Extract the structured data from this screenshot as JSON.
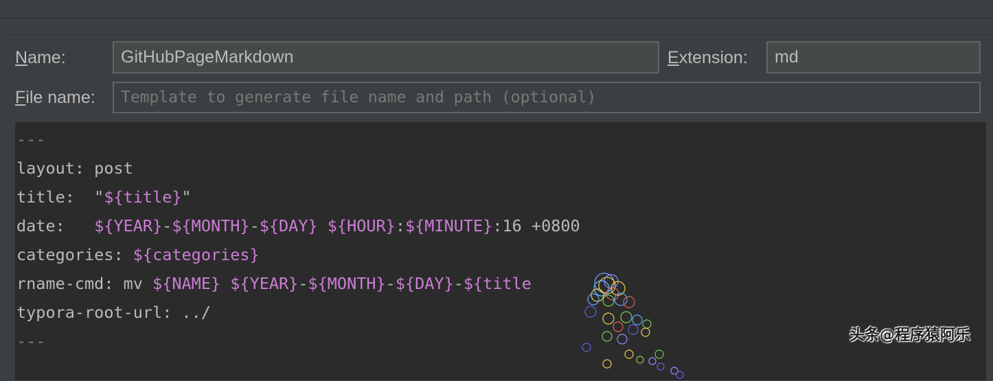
{
  "form": {
    "name_label_mnemonic": "N",
    "name_label_rest": "ame:",
    "name_value": "GitHubPageMarkdown",
    "extension_label_mnemonic": "E",
    "extension_label_rest": "xtension:",
    "extension_value": "md",
    "filename_label_mnemonic": "F",
    "filename_label_rest": "ile name:",
    "filename_placeholder": "Template to generate file name and path (optional)"
  },
  "editor": {
    "lines": [
      [
        {
          "t": "---",
          "c": "dim"
        }
      ],
      [
        {
          "t": "layout: post",
          "c": "txt"
        }
      ],
      [
        {
          "t": "title:  \"",
          "c": "txt"
        },
        {
          "t": "${title}",
          "c": "var"
        },
        {
          "t": "\"",
          "c": "txt"
        }
      ],
      [
        {
          "t": "date:   ",
          "c": "txt"
        },
        {
          "t": "${YEAR}",
          "c": "var"
        },
        {
          "t": "-",
          "c": "txt"
        },
        {
          "t": "${MONTH}",
          "c": "var"
        },
        {
          "t": "-",
          "c": "txt"
        },
        {
          "t": "${DAY}",
          "c": "var"
        },
        {
          "t": " ",
          "c": "txt"
        },
        {
          "t": "${HOUR}",
          "c": "var"
        },
        {
          "t": ":",
          "c": "txt"
        },
        {
          "t": "${MINUTE}",
          "c": "var"
        },
        {
          "t": ":16 +0800",
          "c": "txt"
        }
      ],
      [
        {
          "t": "categories: ",
          "c": "txt"
        },
        {
          "t": "${categories}",
          "c": "var"
        }
      ],
      [
        {
          "t": "rname-cmd: mv ",
          "c": "txt"
        },
        {
          "t": "${NAME}",
          "c": "var"
        },
        {
          "t": " ",
          "c": "txt"
        },
        {
          "t": "${YEAR}",
          "c": "var"
        },
        {
          "t": "-",
          "c": "txt"
        },
        {
          "t": "${MONTH}",
          "c": "var"
        },
        {
          "t": "-",
          "c": "txt"
        },
        {
          "t": "${DAY}",
          "c": "var"
        },
        {
          "t": "-",
          "c": "txt"
        },
        {
          "t": "${title",
          "c": "var"
        }
      ],
      [
        {
          "t": "typora-root-url: ../",
          "c": "txt"
        }
      ],
      [
        {
          "t": "---",
          "c": "dim"
        }
      ]
    ]
  },
  "watermark": "头条@程序猿阿乐",
  "colors": {
    "background": "#3c3f41",
    "editor_background": "#2b2b2b",
    "template_variable": "#cc7ed6",
    "text": "#bababa"
  }
}
